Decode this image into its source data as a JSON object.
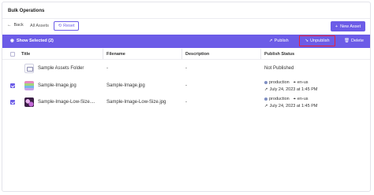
{
  "page": {
    "title": "Bulk Operations"
  },
  "topbar": {
    "back_label": "Back",
    "breadcrumb": "All Assets",
    "reset_label": "Reset",
    "new_asset_label": "New Asset"
  },
  "actionbar": {
    "show_selected_label": "Show Selected (2)",
    "publish_label": "Publish",
    "unpublish_label": "Unpublish",
    "delete_label": "Delete"
  },
  "table": {
    "columns": [
      "Title",
      "Filename",
      "Description",
      "Publish Status"
    ],
    "rows": [
      {
        "title": "Sample Assets Folder",
        "filename": "-",
        "description": "-",
        "status": "Not Published",
        "checked": false,
        "thumb": "folder-icon"
      },
      {
        "title": "Sample-Image.jpg",
        "filename": "Sample-Image.jpg",
        "description": "-",
        "env": "production",
        "locale": "en-us",
        "date": "July 24, 2023 at 1:45 PM",
        "checked": true,
        "thumb": "image-thumbnail"
      },
      {
        "title": "Sample-Image-Low-Size....",
        "filename": "Sample-Image-Low-Size.jpg",
        "description": "-",
        "env": "production",
        "locale": "en-us",
        "date": "July 24, 2023 at 1:45 PM",
        "checked": true,
        "thumb": "image-thumbnail"
      }
    ]
  },
  "colors": {
    "accent": "#6c5ce7",
    "highlight": "#e8213a"
  }
}
